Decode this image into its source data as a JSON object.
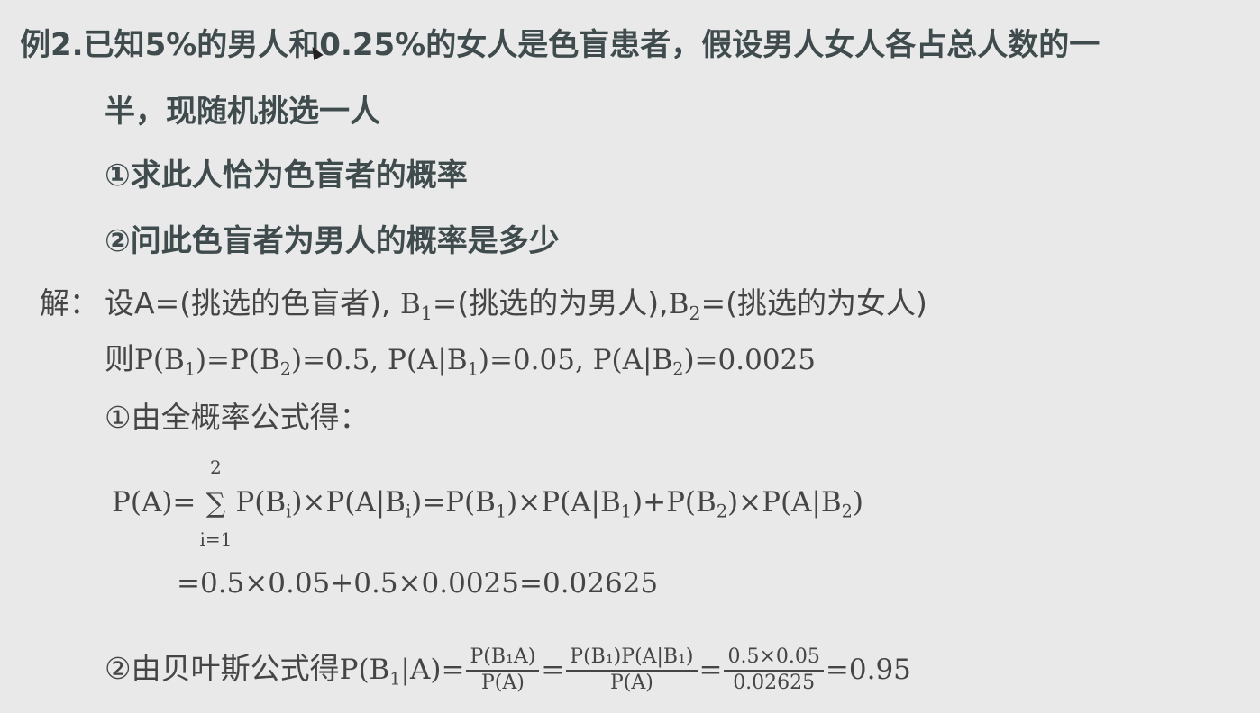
{
  "problem": {
    "line1": "例2.已知5%的男人和0.25%的女人是色盲患者，假设男人女人各占总人数的一",
    "line2": "半，现随机挑选一人",
    "q1": "①求此人恰为色盲者的概率",
    "q2": "②问此色盲者为男人的概率是多少"
  },
  "solution": {
    "label": "解：",
    "define_prefix": "设A=(挑选的色盲者), ",
    "define_b1": "B",
    "define_b1_sub": "1",
    "define_b1_text": "=(挑选的为男人),",
    "define_b2": "B",
    "define_b2_sub": "2",
    "define_b2_text": "=(挑选的为女人)",
    "then_prefix": "则",
    "then_text": {
      "p1": "P(B",
      "p1_sub": "1",
      "p1_mid": ")=P(B",
      "p2_sub": "2",
      "p2_end": ")=0.5, P(A|B",
      "p3_sub": "1",
      "p3_end": ")=0.05, P(A|B",
      "p4_sub": "2",
      "p4_end": ")=0.0025"
    },
    "step1_label": "①由全概率公式得：",
    "total_prob": {
      "lhs": "P(A)=",
      "sum_top": "2",
      "sum_sym": "∑",
      "sum_bot": "i=1",
      "term1": "P(B",
      "term1_sub": "i",
      "term1_end": ")×P(A|B",
      "term2_sub": "i",
      "term2_end": ")=P(B",
      "term3_sub": "1",
      "term3_end": ")×P(A|B",
      "term4_sub": "1",
      "term4_end": ")+P(B",
      "term5_sub": "2",
      "term5_end": ")×P(A|B",
      "term6_sub": "2",
      "term6_end": ")"
    },
    "result1": "=0.5×0.05+0.5×0.0025=0.02625",
    "step2_label": "②由贝叶斯公式得",
    "bayes": {
      "lhs": "P(B",
      "lhs_sub": "1",
      "lhs_end": "|A)=",
      "f1_num": "P(B₁A)",
      "f1_den": "P(A)",
      "eq1": "=",
      "f2_num": "P(B₁)P(A|B₁)",
      "f2_den": "P(A)",
      "eq2": "=",
      "f3_num": "0.5×0.05",
      "f3_den": "0.02625",
      "result": "=0.95"
    }
  }
}
